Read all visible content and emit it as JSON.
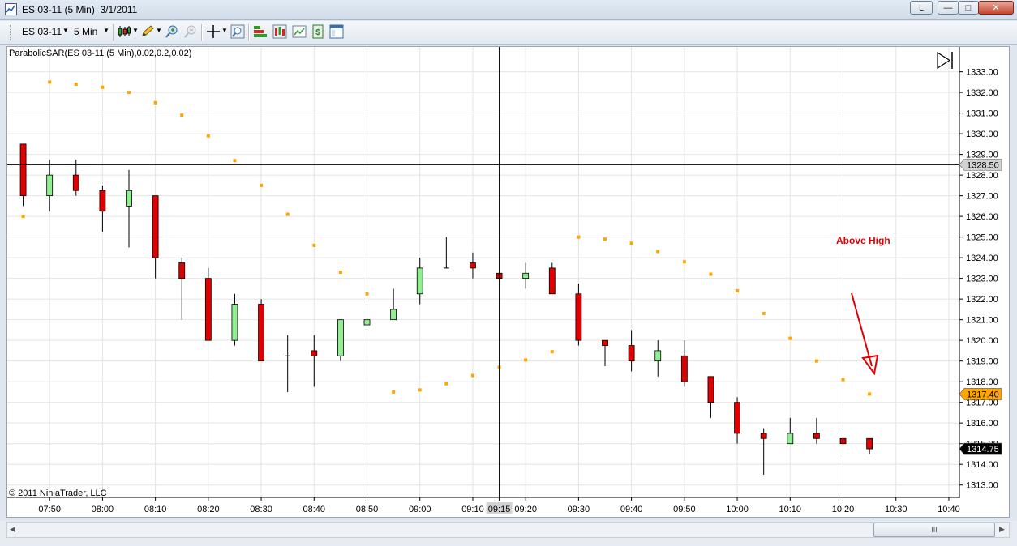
{
  "window": {
    "title": "ES 03-11 (5 Min)  3/1/2011",
    "buttons": {
      "extra": "L",
      "minimize": "—",
      "maximize": "□",
      "close": "✕"
    }
  },
  "toolbar": {
    "instrument": "ES 03-11",
    "interval": "5 Min",
    "icons": [
      "bar-type-candlestick-icon",
      "drawing-pencil-icon",
      "zoom-in-icon",
      "zoom-out-icon",
      "crosshair-icon",
      "magnifier-icon",
      "strategies-icon",
      "indicators-icon",
      "chart-properties-icon",
      "data-box-icon",
      "properties-window-icon"
    ]
  },
  "indicator_label": "ParabolicSAR(ES 03-11 (5 Min),0.02,0.2,0.02)",
  "copyright": "© 2011 NinjaTrader, LLC",
  "annotation": {
    "text": "Above High",
    "color": "#e00000"
  },
  "scrollbar": {
    "thumb_grip": "III"
  },
  "colors": {
    "up": "#90ee90",
    "down": "#e00000",
    "sar": "#ffa500",
    "price_badge": "#000000",
    "sar_badge": "#ffa500"
  },
  "chart_data": {
    "type": "candlestick",
    "x_ticks": [
      "07:50",
      "08:00",
      "08:10",
      "08:20",
      "08:30",
      "08:40",
      "08:50",
      "09:00",
      "09:10",
      "09:15",
      "09:20",
      "09:30",
      "09:40",
      "09:50",
      "10:00",
      "10:10",
      "10:20",
      "10:30",
      "10:40"
    ],
    "y_ticks": [
      "1313.00",
      "1314.00",
      "1315.00",
      "1316.00",
      "1317.00",
      "1318.00",
      "1319.00",
      "1320.00",
      "1321.00",
      "1322.00",
      "1323.00",
      "1324.00",
      "1325.00",
      "1326.00",
      "1327.00",
      "1328.00",
      "1329.00",
      "1330.00",
      "1331.00",
      "1332.00",
      "1333.00"
    ],
    "ylim": [
      1312.4,
      1334.2
    ],
    "xlim_minutes": [
      "07:42",
      "10:42"
    ],
    "crosshair": {
      "time": "09:15",
      "price": "1328.50"
    },
    "last_price_label": "1314.75",
    "last_sar_label": "1317.40",
    "candles": [
      {
        "t": "07:45",
        "o": 1329.5,
        "h": 1329.5,
        "l": 1326.5,
        "c": 1327.0
      },
      {
        "t": "07:50",
        "o": 1327.0,
        "h": 1328.75,
        "l": 1326.25,
        "c": 1328.0
      },
      {
        "t": "07:55",
        "o": 1328.0,
        "h": 1328.75,
        "l": 1327.0,
        "c": 1327.25
      },
      {
        "t": "08:00",
        "o": 1327.25,
        "h": 1327.5,
        "l": 1325.25,
        "c": 1326.25
      },
      {
        "t": "08:05",
        "o": 1326.5,
        "h": 1328.25,
        "l": 1324.5,
        "c": 1327.25
      },
      {
        "t": "08:10",
        "o": 1327.0,
        "h": 1327.0,
        "l": 1323.0,
        "c": 1324.0
      },
      {
        "t": "08:15",
        "o": 1323.75,
        "h": 1324.0,
        "l": 1321.0,
        "c": 1323.0
      },
      {
        "t": "08:20",
        "o": 1323.0,
        "h": 1323.5,
        "l": 1320.0,
        "c": 1320.0
      },
      {
        "t": "08:25",
        "o": 1320.0,
        "h": 1322.25,
        "l": 1319.75,
        "c": 1321.75
      },
      {
        "t": "08:30",
        "o": 1321.75,
        "h": 1322.0,
        "l": 1319.0,
        "c": 1319.0
      },
      {
        "t": "08:35",
        "o": 1319.25,
        "h": 1320.25,
        "l": 1317.5,
        "c": 1319.25
      },
      {
        "t": "08:40",
        "o": 1319.5,
        "h": 1320.25,
        "l": 1317.75,
        "c": 1319.25
      },
      {
        "t": "08:45",
        "o": 1319.25,
        "h": 1321.0,
        "l": 1319.0,
        "c": 1321.0
      },
      {
        "t": "08:50",
        "o": 1320.75,
        "h": 1321.75,
        "l": 1320.5,
        "c": 1321.0
      },
      {
        "t": "08:55",
        "o": 1321.0,
        "h": 1322.5,
        "l": 1321.0,
        "c": 1321.5
      },
      {
        "t": "09:00",
        "o": 1322.25,
        "h": 1324.0,
        "l": 1321.75,
        "c": 1323.5
      },
      {
        "t": "09:05",
        "o": 1323.5,
        "h": 1325.0,
        "l": 1323.5,
        "c": 1323.5
      },
      {
        "t": "09:10",
        "o": 1323.75,
        "h": 1324.25,
        "l": 1323.0,
        "c": 1323.5
      },
      {
        "t": "09:15",
        "o": 1323.25,
        "h": 1323.25,
        "l": 1323.0,
        "c": 1323.0
      },
      {
        "t": "09:20",
        "o": 1323.0,
        "h": 1323.75,
        "l": 1322.5,
        "c": 1323.25
      },
      {
        "t": "09:25",
        "o": 1323.5,
        "h": 1323.75,
        "l": 1322.25,
        "c": 1322.25
      },
      {
        "t": "09:30",
        "o": 1322.25,
        "h": 1322.75,
        "l": 1319.75,
        "c": 1320.0
      },
      {
        "t": "09:35",
        "o": 1320.0,
        "h": 1320.0,
        "l": 1318.75,
        "c": 1319.75
      },
      {
        "t": "09:40",
        "o": 1319.75,
        "h": 1320.5,
        "l": 1318.5,
        "c": 1319.0
      },
      {
        "t": "09:45",
        "o": 1319.0,
        "h": 1320.0,
        "l": 1318.25,
        "c": 1319.5
      },
      {
        "t": "09:50",
        "o": 1319.25,
        "h": 1320.0,
        "l": 1317.75,
        "c": 1318.0
      },
      {
        "t": "09:55",
        "o": 1318.25,
        "h": 1318.25,
        "l": 1316.25,
        "c": 1317.0
      },
      {
        "t": "10:00",
        "o": 1317.0,
        "h": 1317.25,
        "l": 1315.0,
        "c": 1315.5
      },
      {
        "t": "10:05",
        "o": 1315.5,
        "h": 1315.75,
        "l": 1313.5,
        "c": 1315.25
      },
      {
        "t": "10:10",
        "o": 1315.0,
        "h": 1316.25,
        "l": 1315.0,
        "c": 1315.5
      },
      {
        "t": "10:15",
        "o": 1315.5,
        "h": 1316.25,
        "l": 1315.0,
        "c": 1315.25
      },
      {
        "t": "10:20",
        "o": 1315.25,
        "h": 1315.75,
        "l": 1314.5,
        "c": 1315.0
      },
      {
        "t": "10:25",
        "o": 1315.25,
        "h": 1315.25,
        "l": 1314.5,
        "c": 1314.75
      }
    ],
    "sar": [
      {
        "t": "07:45",
        "v": 1326.0
      },
      {
        "t": "07:50",
        "v": 1332.5
      },
      {
        "t": "07:55",
        "v": 1332.4
      },
      {
        "t": "08:00",
        "v": 1332.25
      },
      {
        "t": "08:05",
        "v": 1332.0
      },
      {
        "t": "08:10",
        "v": 1331.5
      },
      {
        "t": "08:15",
        "v": 1330.9
      },
      {
        "t": "08:20",
        "v": 1329.9
      },
      {
        "t": "08:25",
        "v": 1328.7
      },
      {
        "t": "08:30",
        "v": 1327.5
      },
      {
        "t": "08:35",
        "v": 1326.1
      },
      {
        "t": "08:40",
        "v": 1324.6
      },
      {
        "t": "08:45",
        "v": 1323.3
      },
      {
        "t": "08:50",
        "v": 1322.25
      },
      {
        "t": "08:55",
        "v": 1317.5
      },
      {
        "t": "09:00",
        "v": 1317.6
      },
      {
        "t": "09:05",
        "v": 1317.9
      },
      {
        "t": "09:10",
        "v": 1318.3
      },
      {
        "t": "09:15",
        "v": 1318.7
      },
      {
        "t": "09:20",
        "v": 1319.05
      },
      {
        "t": "09:25",
        "v": 1319.45
      },
      {
        "t": "09:30",
        "v": 1325.0
      },
      {
        "t": "09:35",
        "v": 1324.9
      },
      {
        "t": "09:40",
        "v": 1324.7
      },
      {
        "t": "09:45",
        "v": 1324.3
      },
      {
        "t": "09:50",
        "v": 1323.8
      },
      {
        "t": "09:55",
        "v": 1323.2
      },
      {
        "t": "10:00",
        "v": 1322.4
      },
      {
        "t": "10:05",
        "v": 1321.3
      },
      {
        "t": "10:10",
        "v": 1320.1
      },
      {
        "t": "10:15",
        "v": 1319.0
      },
      {
        "t": "10:20",
        "v": 1318.1
      },
      {
        "t": "10:25",
        "v": 1317.4
      }
    ]
  }
}
